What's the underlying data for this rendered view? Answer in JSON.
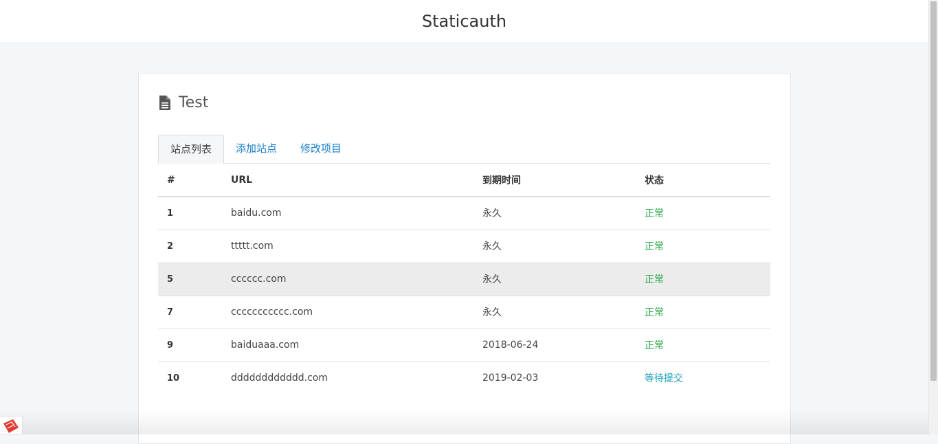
{
  "app": {
    "title": "Staticauth"
  },
  "panel": {
    "title": "Test",
    "icon": "document-icon"
  },
  "tabs": [
    {
      "label": "站点列表",
      "active": true
    },
    {
      "label": "添加站点",
      "active": false
    },
    {
      "label": "修改项目",
      "active": false
    }
  ],
  "table": {
    "headers": [
      "#",
      "URL",
      "到期时间",
      "状态"
    ],
    "rows": [
      {
        "id": "1",
        "url": "baidu.com",
        "expire": "永久",
        "status": "正常",
        "status_type": "ok"
      },
      {
        "id": "2",
        "url": "ttttt.com",
        "expire": "永久",
        "status": "正常",
        "status_type": "ok"
      },
      {
        "id": "5",
        "url": "cccccc.com",
        "expire": "永久",
        "status": "正常",
        "status_type": "ok"
      },
      {
        "id": "7",
        "url": "ccccccccccc.com",
        "expire": "永久",
        "status": "正常",
        "status_type": "ok"
      },
      {
        "id": "9",
        "url": "baiduaaa.com",
        "expire": "2018-06-24",
        "status": "正常",
        "status_type": "ok"
      },
      {
        "id": "10",
        "url": "dddddddddddd.com",
        "expire": "2019-02-03",
        "status": "等待提交",
        "status_type": "wait"
      }
    ]
  },
  "colors": {
    "link": "#1a7fc9",
    "ok": "#27a745",
    "wait": "#17a2b8"
  }
}
